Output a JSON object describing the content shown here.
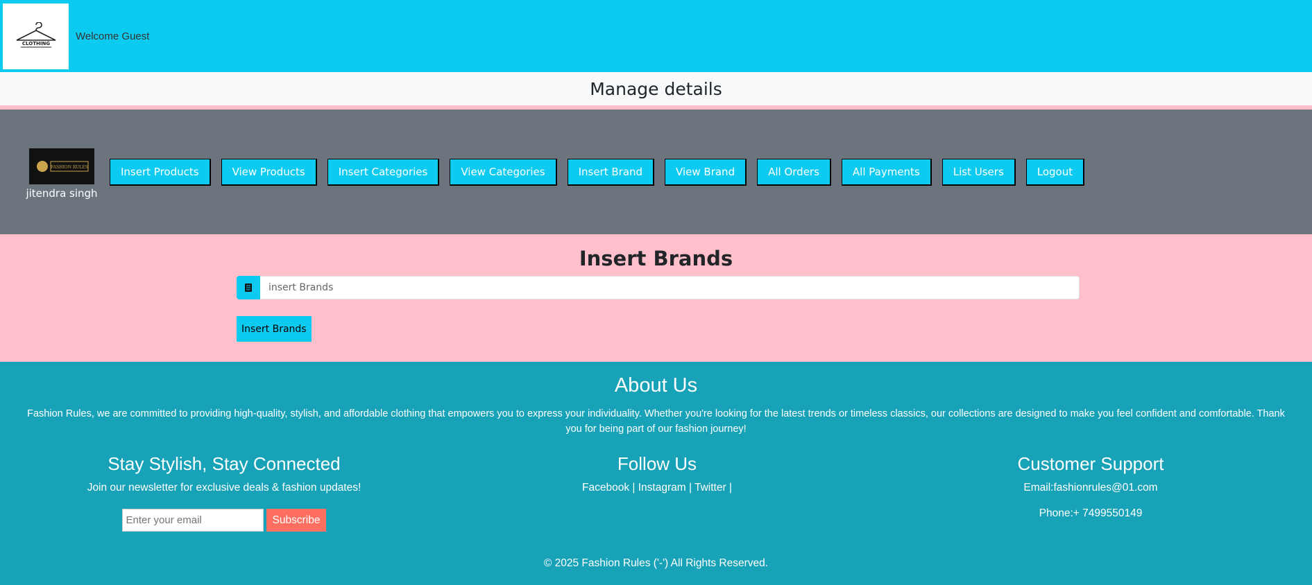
{
  "header": {
    "logo_text": "CLOTHING",
    "welcome": "Welcome Guest"
  },
  "manage": {
    "title": "Manage details"
  },
  "admin": {
    "logo_text": "FASHION RULES",
    "name": "jitendra singh",
    "nav": [
      "Insert Products",
      "View Products",
      "Insert Categories",
      "View Categories",
      "Insert Brand",
      "View Brand",
      "All Orders",
      "All Payments",
      "List Users",
      "Logout"
    ]
  },
  "insert": {
    "title": "Insert Brands",
    "input_placeholder": "insert Brands",
    "button_label": "Insert Brands"
  },
  "footer": {
    "about_title": "About Us",
    "about_text": "Fashion Rules, we are committed to providing high-quality, stylish, and affordable clothing that empowers you to express your individuality. Whether you're looking for the latest trends or timeless classics, our collections are designed to make you feel confident and comfortable. Thank you for being part of our fashion journey!",
    "newsletter_title": "Stay Stylish, Stay Connected",
    "newsletter_text": "Join our newsletter for exclusive deals & fashion updates!",
    "email_placeholder": "Enter your email",
    "subscribe_label": "Subscribe",
    "follow_title": "Follow Us",
    "social": [
      "Facebook",
      "Instagram",
      "Twitter"
    ],
    "support_title": "Customer Support",
    "support_email": "Email:fashionrules@01.com",
    "support_phone": "Phone:+ 7499550149",
    "copyright": "© 2025 Fashion Rules ('-') All Rights Reserved."
  }
}
